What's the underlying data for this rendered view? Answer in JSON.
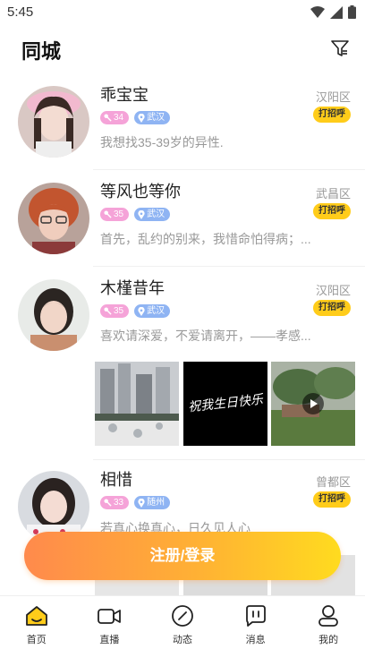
{
  "status_bar": {
    "time": "5:45"
  },
  "header": {
    "title": "同城"
  },
  "users": [
    {
      "nickname": "乖宝宝",
      "age": "34",
      "city": "武汉",
      "district": "汉阳区",
      "greet": "打招呼",
      "bio": "我想找35-39岁的异性."
    },
    {
      "nickname": "等风也等你",
      "age": "35",
      "city": "武汉",
      "district": "武昌区",
      "greet": "打招呼",
      "bio": "首先，乱约的别来，我惜命怕得病；..."
    },
    {
      "nickname": "木槿昔年",
      "age": "35",
      "city": "武汉",
      "district": "汉阳区",
      "greet": "打招呼",
      "bio": "喜欢请深爱，不爱请离开，——孝感..."
    },
    {
      "nickname": "相惜",
      "age": "33",
      "city": "随州",
      "district": "曾都区",
      "greet": "打招呼",
      "bio": "若真心换真心，日久见人心"
    }
  ],
  "photo_text": "祝我生日快乐",
  "login_button": {
    "label": "注册/登录"
  },
  "tabs": [
    {
      "label": "首页",
      "icon": "home-icon"
    },
    {
      "label": "直播",
      "icon": "video-icon"
    },
    {
      "label": "动态",
      "icon": "compass-icon"
    },
    {
      "label": "消息",
      "icon": "message-icon"
    },
    {
      "label": "我的",
      "icon": "profile-icon"
    }
  ],
  "colors": {
    "accent": "#ffcc1a",
    "gradient_start": "#ff8a4c",
    "gradient_end": "#ffdb1f",
    "age_tag": "#f5a3d8",
    "city_tag": "#8fb4f3"
  }
}
